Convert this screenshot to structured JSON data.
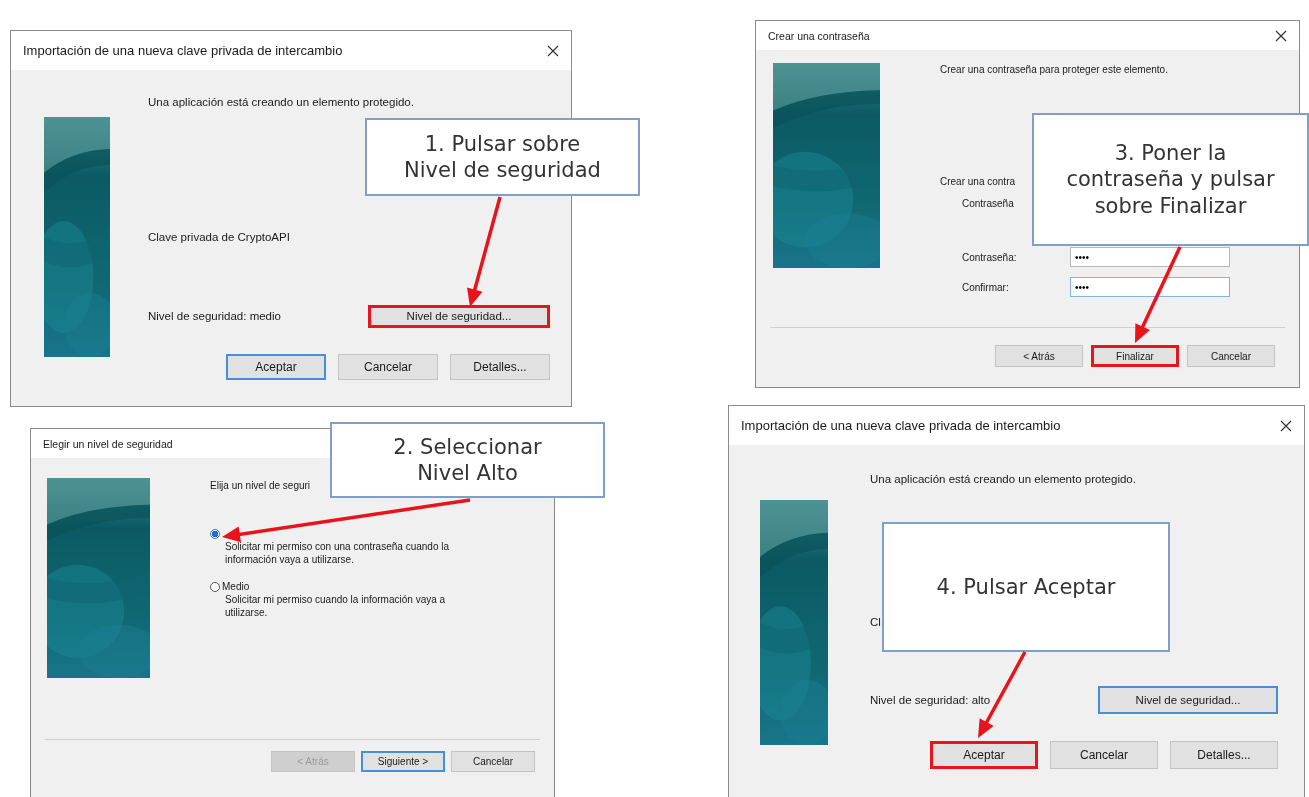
{
  "dialogs": [
    {
      "kind": "import",
      "title": "Importación de una nueva clave privada de intercambio",
      "close": true,
      "intro": "Una aplicación está creando un elemento protegido.",
      "item": "Clave privada de CryptoAPI",
      "level_text": "Nivel de seguridad: medio",
      "level_button": {
        "label": "Nivel de seguridad...",
        "default": false,
        "highlighted": true,
        "disabled": false
      },
      "buttons": [
        {
          "label": "Aceptar",
          "default": true,
          "highlighted": false,
          "disabled": false
        },
        {
          "label": "Cancelar",
          "default": false,
          "highlighted": false,
          "disabled": false
        },
        {
          "label": "Detalles...",
          "default": false,
          "highlighted": false,
          "disabled": false
        }
      ],
      "callout": [
        "1. Pulsar sobre",
        "Nivel de seguridad"
      ]
    },
    {
      "kind": "security_level",
      "title": "Elegir un nivel de seguridad",
      "intro": "Elija un nivel de seguri",
      "options": [
        {
          "selected": true,
          "description": "Solicitar mi permiso con una contraseña cuando la información vaya a utilizarse."
        },
        {
          "label": "Medio",
          "selected": false,
          "description": "Solicitar mi permiso cuando la información vaya a utilizarse."
        }
      ],
      "buttons": [
        {
          "label": "< Atrás",
          "default": false,
          "highlighted": false,
          "disabled": true
        },
        {
          "label": "Siguiente >",
          "default": true,
          "highlighted": false,
          "disabled": false
        },
        {
          "label": "Cancelar",
          "default": false,
          "highlighted": false,
          "disabled": false
        }
      ],
      "callout": [
        "2. Seleccionar",
        "Nivel Alto"
      ]
    },
    {
      "kind": "password",
      "title": "Crear una contraseña",
      "close": true,
      "intro": "Crear una contraseña para proteger este elemento.",
      "prompt": "Crear una contra",
      "prompt_sub": "Contraseña",
      "fields": [
        {
          "label": "Contraseña:",
          "value": "••••",
          "focused": false
        },
        {
          "label": "Confirmar:",
          "value": "••••",
          "focused": true
        }
      ],
      "buttons": [
        {
          "label": "< Atrás",
          "default": false,
          "highlighted": false,
          "disabled": false
        },
        {
          "label": "Finalizar",
          "default": true,
          "highlighted": true,
          "disabled": false
        },
        {
          "label": "Cancelar",
          "default": false,
          "highlighted": false,
          "disabled": false
        }
      ],
      "callout": [
        "3. Poner la",
        "contraseña y pulsar",
        "sobre Finalizar"
      ]
    },
    {
      "kind": "import",
      "title": "Importación de una nueva clave privada de intercambio",
      "close": true,
      "intro": "Una aplicación está creando un elemento protegido.",
      "item": "Cl",
      "level_text": "Nivel de seguridad: alto",
      "level_button": {
        "label": "Nivel de seguridad...",
        "default": true,
        "highlighted": false,
        "disabled": false
      },
      "buttons": [
        {
          "label": "Aceptar",
          "default": true,
          "highlighted": true,
          "disabled": false
        },
        {
          "label": "Cancelar",
          "default": false,
          "highlighted": false,
          "disabled": false
        },
        {
          "label": "Detalles...",
          "default": false,
          "highlighted": false,
          "disabled": false
        }
      ],
      "callout": [
        "4. Pulsar Aceptar"
      ]
    }
  ]
}
